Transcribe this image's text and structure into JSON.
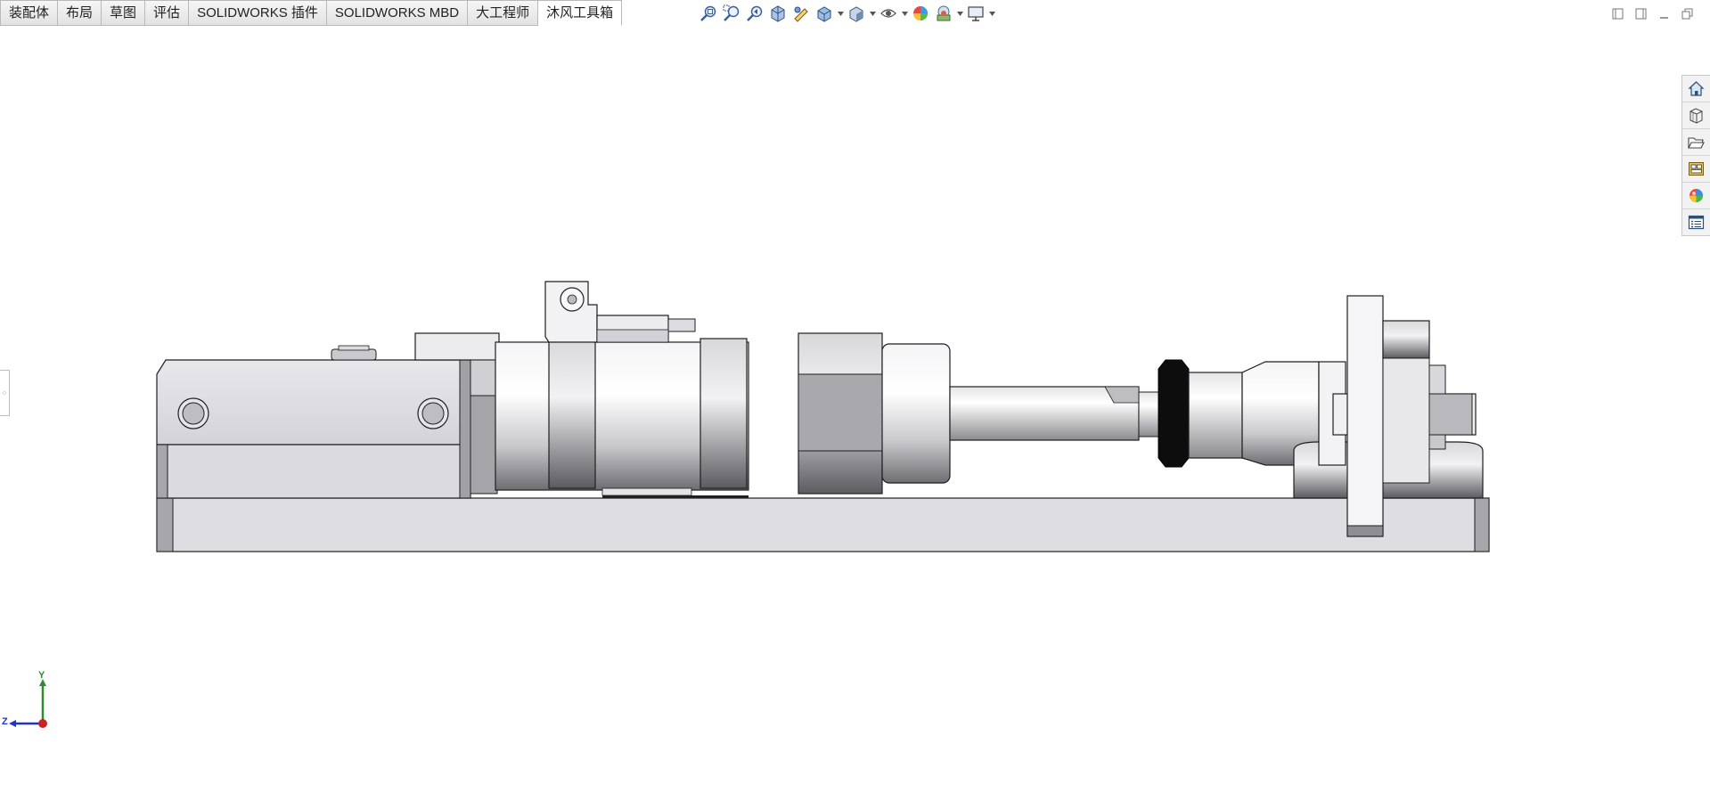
{
  "tabs": [
    {
      "label": "装配体",
      "active": false
    },
    {
      "label": "布局",
      "active": false
    },
    {
      "label": "草图",
      "active": false
    },
    {
      "label": "评估",
      "active": false
    },
    {
      "label": "SOLIDWORKS 插件",
      "active": false
    },
    {
      "label": "SOLIDWORKS MBD",
      "active": false
    },
    {
      "label": "大工程师",
      "active": false
    },
    {
      "label": "沐风工具箱",
      "active": true
    }
  ],
  "hud_toolbar": [
    {
      "icon": "zoom-to-fit-icon"
    },
    {
      "icon": "zoom-to-area-icon"
    },
    {
      "icon": "previous-view-icon"
    },
    {
      "icon": "section-view-icon"
    },
    {
      "icon": "dynamic-annotation-icon"
    },
    {
      "icon": "view-orientation-icon",
      "dropdown": true
    },
    {
      "icon": "display-style-icon",
      "dropdown": true
    },
    {
      "icon": "hide-show-items-icon",
      "dropdown": true
    },
    {
      "icon": "edit-appearance-icon"
    },
    {
      "icon": "apply-scene-icon",
      "dropdown": true
    },
    {
      "icon": "view-settings-icon",
      "dropdown": true
    }
  ],
  "window_controls": [
    "restore-left-icon",
    "restore-right-icon",
    "minimize-icon",
    "maximize-icon"
  ],
  "task_pane": [
    {
      "icon": "solidworks-resources-icon"
    },
    {
      "icon": "design-library-icon"
    },
    {
      "icon": "file-explorer-icon"
    },
    {
      "icon": "view-palette-icon"
    },
    {
      "icon": "appearances-scenes-icon"
    },
    {
      "icon": "custom-properties-icon"
    }
  ],
  "triad": {
    "y_label": "Y",
    "z_label": "Z"
  },
  "colors": {
    "tab_active": "#ffffff",
    "tab_inactive": "#e6e6e6",
    "background": "#ffffff",
    "part_light": "#dcdce0",
    "part_dark": "#9a9a9e",
    "edge": "#1f1f1f",
    "triad_y": "#2e8b2e",
    "triad_z": "#2233cc",
    "triad_origin": "#cc2222"
  }
}
